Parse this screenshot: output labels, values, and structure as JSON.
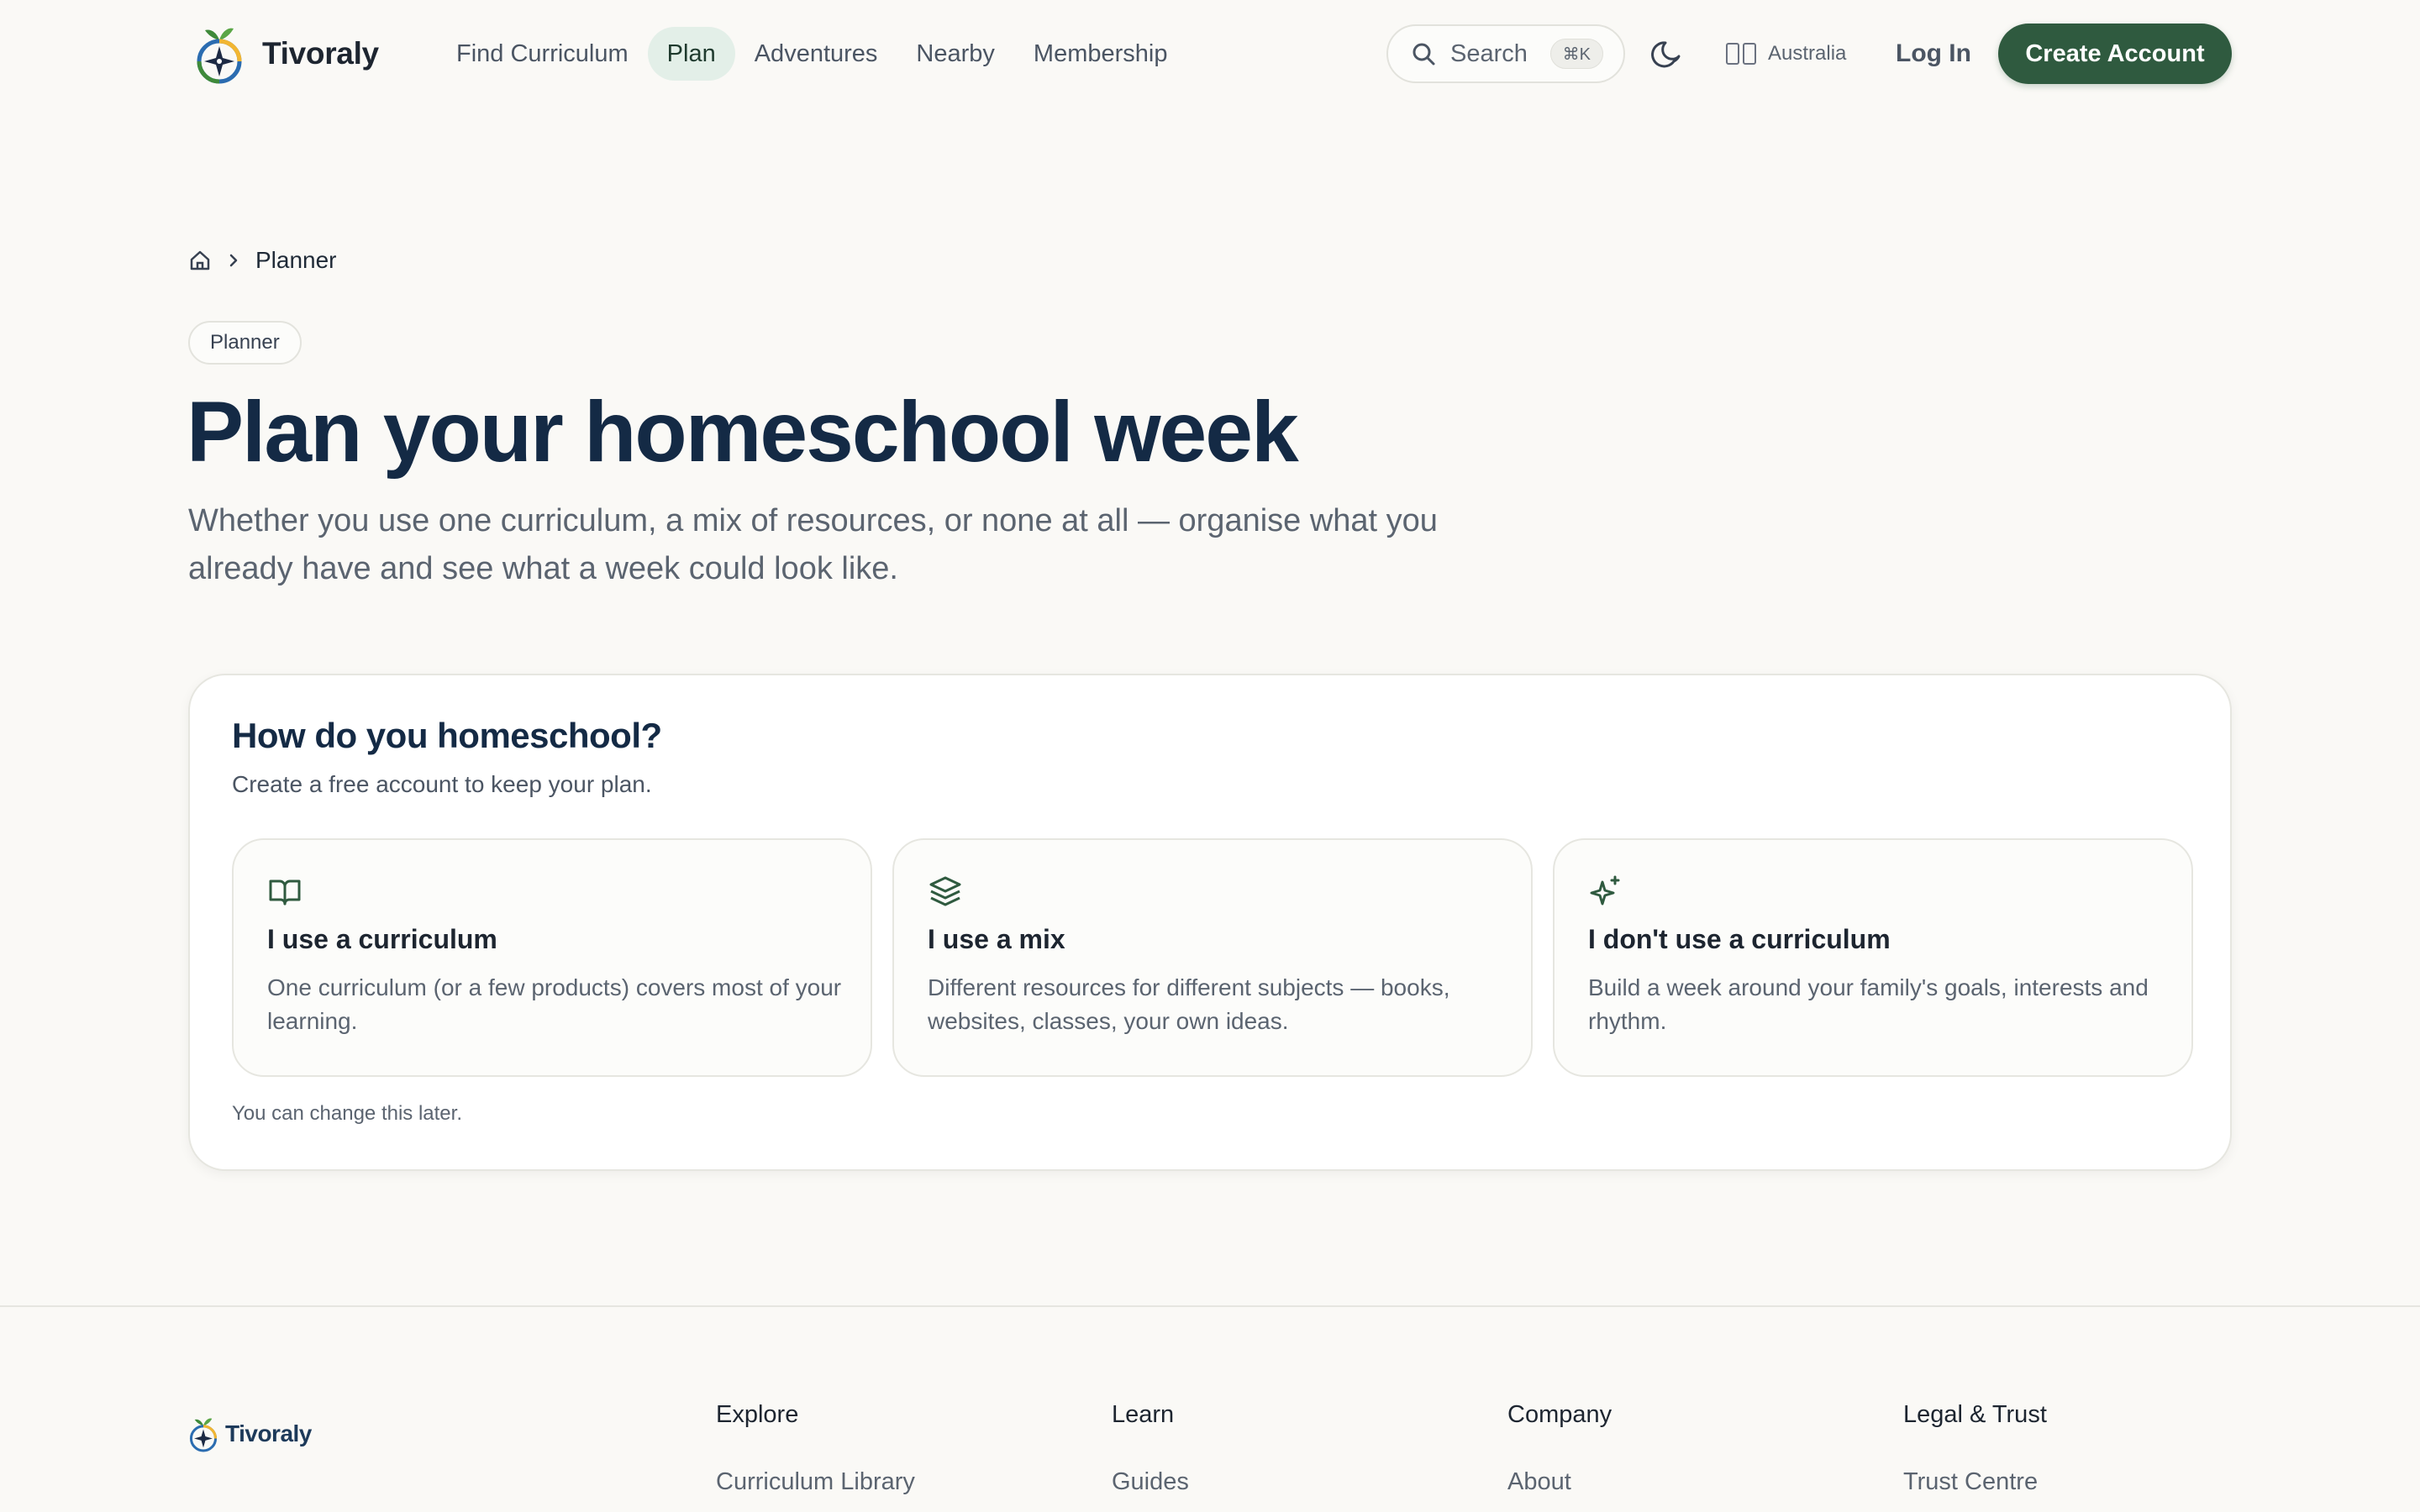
{
  "header": {
    "brand": "Tivoraly",
    "nav": [
      {
        "label": "Find Curriculum",
        "active": false
      },
      {
        "label": "Plan",
        "active": true
      },
      {
        "label": "Adventures",
        "active": false
      },
      {
        "label": "Nearby",
        "active": false
      },
      {
        "label": "Membership",
        "active": false
      }
    ],
    "search": {
      "label": "Search",
      "shortcut": "⌘K"
    },
    "region": "Australia",
    "login_label": "Log In",
    "create_account_label": "Create Account"
  },
  "breadcrumb": {
    "current": "Planner"
  },
  "hero": {
    "pill": "Planner",
    "title": "Plan your homeschool week",
    "subtitle": "Whether you use one curriculum, a mix of resources, or none at all — organise what you already have and see what a week could look like."
  },
  "card": {
    "title": "How do you homeschool?",
    "subtitle": "Create a free account to keep your plan.",
    "options": [
      {
        "icon": "book-open-icon",
        "title": "I use a curriculum",
        "description": "One curriculum (or a few products) covers most of your learning."
      },
      {
        "icon": "layers-icon",
        "title": "I use a mix",
        "description": "Different resources for different subjects — books, websites, classes, your own ideas."
      },
      {
        "icon": "sparkles-icon",
        "title": "I don't use a curriculum",
        "description": "Build a week around your family's goals, interests and rhythm."
      }
    ],
    "note": "You can change this later."
  },
  "footer": {
    "brand": "Tivoraly",
    "columns": [
      {
        "title": "Explore",
        "first_link": "Curriculum Library"
      },
      {
        "title": "Learn",
        "first_link": "Guides"
      },
      {
        "title": "Company",
        "first_link": "About"
      },
      {
        "title": "Legal & Trust",
        "first_link": "Trust Centre"
      }
    ]
  },
  "colors": {
    "accent": "#2f5a3f",
    "heading": "#142a45",
    "background": "#faf9f6",
    "nav_active_bg": "#e3efe8"
  }
}
